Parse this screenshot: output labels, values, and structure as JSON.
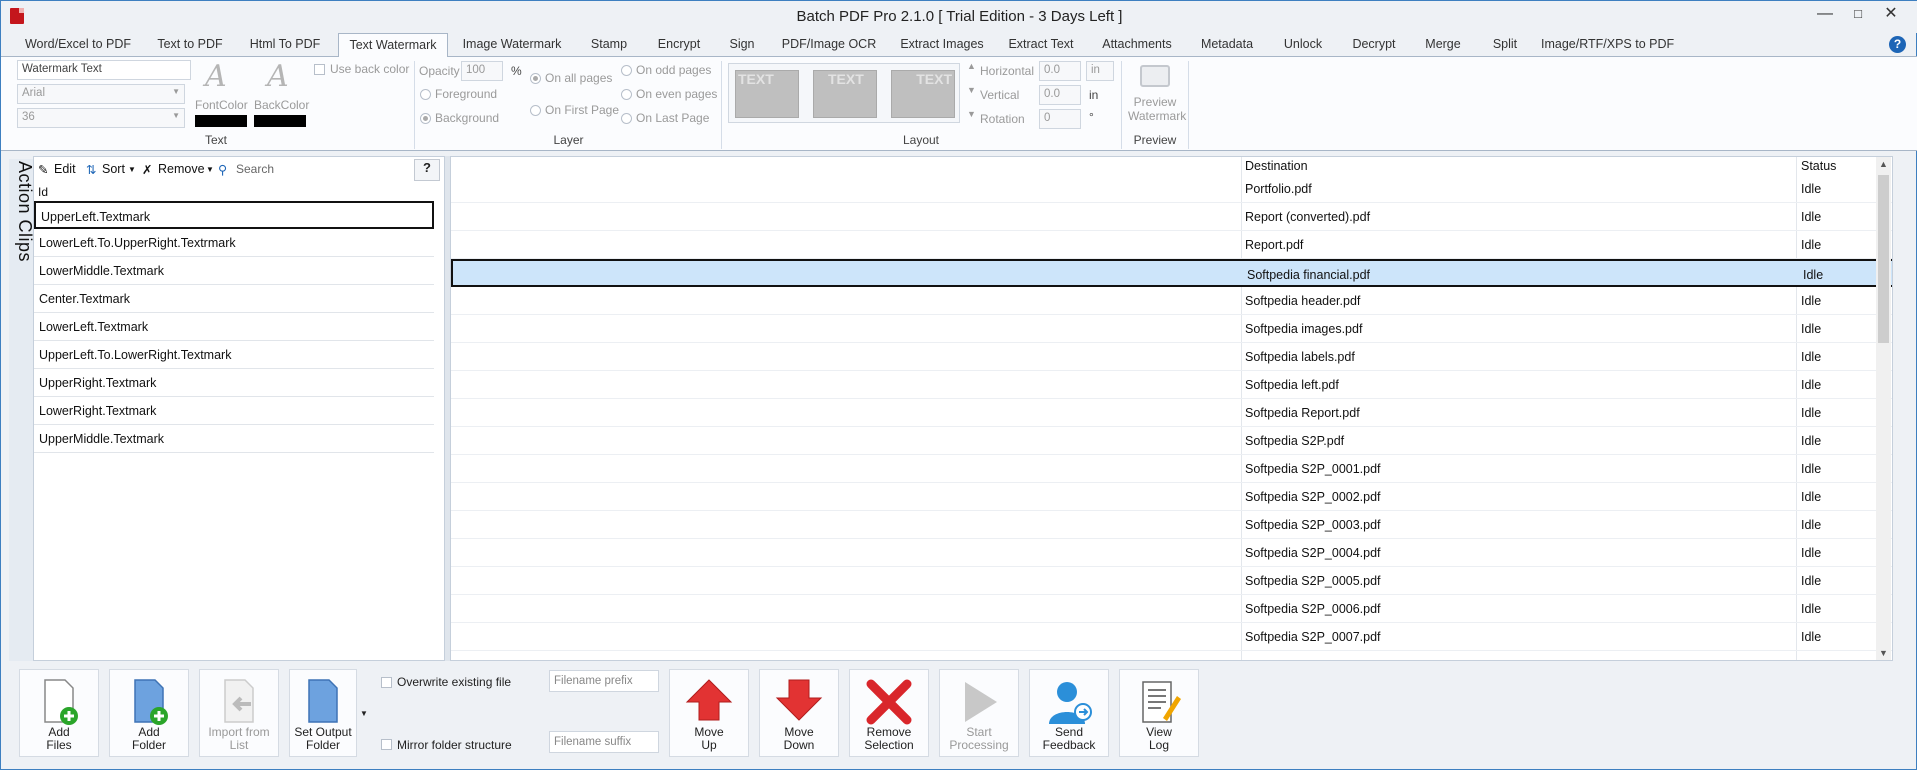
{
  "window": {
    "title": "Batch PDF Pro 2.1.0 [ Trial Edition - 3 Days Left ]"
  },
  "tabs": [
    {
      "label": "Word/Excel to PDF"
    },
    {
      "label": "Text to PDF"
    },
    {
      "label": "Html To PDF"
    },
    {
      "label": "Text Watermark"
    },
    {
      "label": "Image Watermark"
    },
    {
      "label": "Stamp"
    },
    {
      "label": "Encrypt"
    },
    {
      "label": "Sign"
    },
    {
      "label": "PDF/Image OCR"
    },
    {
      "label": "Extract Images"
    },
    {
      "label": "Extract Text"
    },
    {
      "label": "Attachments"
    },
    {
      "label": "Metadata"
    },
    {
      "label": "Unlock"
    },
    {
      "label": "Decrypt"
    },
    {
      "label": "Merge"
    },
    {
      "label": "Split"
    },
    {
      "label": "Image/RTF/XPS to PDF"
    }
  ],
  "ribbon": {
    "text_group": {
      "label": "Text",
      "watermark_text": "Watermark Text",
      "font": "Arial",
      "size": "36",
      "font_color_label": "FontColor",
      "back_color_label": "BackColor",
      "use_back_color_label": "Use back color",
      "font_color": "#000000",
      "back_color": "#000000"
    },
    "layer_group": {
      "label": "Layer",
      "opacity_label": "Opacity",
      "opacity_value": "100",
      "opacity_unit": "%",
      "foreground_label": "Foreground",
      "background_label": "Background",
      "on_all_pages": "On all pages",
      "on_first_page": "On First Page",
      "on_odd_pages": "On odd pages",
      "on_even_pages": "On even pages",
      "on_last_page": "On Last Page"
    },
    "layout_group": {
      "label": "Layout",
      "preview_text": "TEXT",
      "horizontal_label": "Horizontal",
      "horizontal_value": "0.0",
      "horizontal_unit": "in",
      "vertical_label": "Vertical",
      "vertical_value": "0.0",
      "vertical_unit": "in",
      "rotation_label": "Rotation",
      "rotation_value": "0",
      "rotation_unit": "°"
    },
    "preview_group": {
      "label": "Preview",
      "button_label_1": "Preview",
      "button_label_2": "Watermark"
    }
  },
  "action_clips": {
    "panel_title": "Action Clips",
    "toolbar": {
      "edit": "Edit",
      "sort": "Sort",
      "remove": "Remove",
      "search_placeholder": "Search",
      "help": "?"
    },
    "column": "Id",
    "items": [
      "UpperLeft.Textmark",
      "LowerLeft.To.UpperRight.Textrmark",
      "LowerMiddle.Textmark",
      "Center.Textmark",
      "LowerLeft.Textmark",
      "UpperLeft.To.LowerRight.Textmark",
      "UpperRight.Textmark",
      "LowerRight.Textmark",
      "UpperMiddle.Textmark"
    ]
  },
  "file_grid": {
    "columns": {
      "destination": "Destination",
      "status": "Status"
    },
    "rows": [
      {
        "destination": "Portfolio.pdf",
        "status": "Idle"
      },
      {
        "destination": "Report (converted).pdf",
        "status": "Idle"
      },
      {
        "destination": "Report.pdf",
        "status": "Idle"
      },
      {
        "destination": "Softpedia financial.pdf",
        "status": "Idle"
      },
      {
        "destination": "Softpedia header.pdf",
        "status": "Idle"
      },
      {
        "destination": "Softpedia images.pdf",
        "status": "Idle"
      },
      {
        "destination": "Softpedia labels.pdf",
        "status": "Idle"
      },
      {
        "destination": "Softpedia left.pdf",
        "status": "Idle"
      },
      {
        "destination": "Softpedia Report.pdf",
        "status": "Idle"
      },
      {
        "destination": "Softpedia S2P.pdf",
        "status": "Idle"
      },
      {
        "destination": "Softpedia S2P_0001.pdf",
        "status": "Idle"
      },
      {
        "destination": "Softpedia S2P_0002.pdf",
        "status": "Idle"
      },
      {
        "destination": "Softpedia S2P_0003.pdf",
        "status": "Idle"
      },
      {
        "destination": "Softpedia S2P_0004.pdf",
        "status": "Idle"
      },
      {
        "destination": "Softpedia S2P_0005.pdf",
        "status": "Idle"
      },
      {
        "destination": "Softpedia S2P_0006.pdf",
        "status": "Idle"
      },
      {
        "destination": "Softpedia S2P_0007.pdf",
        "status": "Idle"
      }
    ]
  },
  "bottom_toolbar": {
    "add_files": [
      "Add",
      "Files"
    ],
    "add_folder": [
      "Add",
      "Folder"
    ],
    "import_from_list": [
      "Import from List"
    ],
    "set_output_folder": [
      "Set Output",
      "Folder"
    ],
    "overwrite_label": "Overwrite existing file",
    "mirror_label": "Mirror folder structure",
    "filename_prefix_placeholder": "Filename prefix",
    "filename_suffix_placeholder": "Filename suffix",
    "move_up": [
      "Move",
      "Up"
    ],
    "move_down": [
      "Move",
      "Down"
    ],
    "remove_selection": [
      "Remove",
      "Selection"
    ],
    "start_processing": [
      "Start",
      "Processing"
    ],
    "send_feedback": [
      "Send",
      "Feedback"
    ],
    "view_log": [
      "View",
      "Log"
    ]
  }
}
